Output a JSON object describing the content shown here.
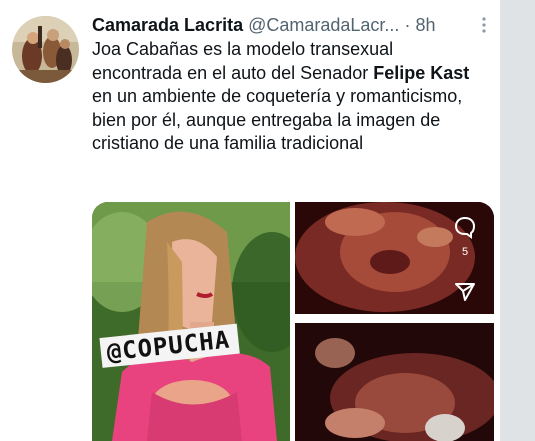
{
  "tweet": {
    "author": {
      "display_name": "Camarada Lacrita",
      "handle": "@CamaradaLacr...",
      "separator": "·",
      "timestamp": "8h"
    },
    "text": {
      "part1": "Joa Cabañas es la modelo transexual encontrada en el auto del Senador ",
      "bold": "Felipe Kast",
      "part2": " en un ambiente de coquetería y romanticismo, bien por él, aunque entregaba la imagen de cristiano de una familia tradicional"
    },
    "media": {
      "watermark": "@COPUCHA",
      "comment_count": "5"
    }
  },
  "colors": {
    "text": "#0f1419",
    "secondary": "#536471",
    "background": "#ffffff",
    "frame": "#dfe3e6"
  },
  "icons": {
    "more": "more-options-icon",
    "comment": "comment-icon",
    "share": "share-icon"
  }
}
